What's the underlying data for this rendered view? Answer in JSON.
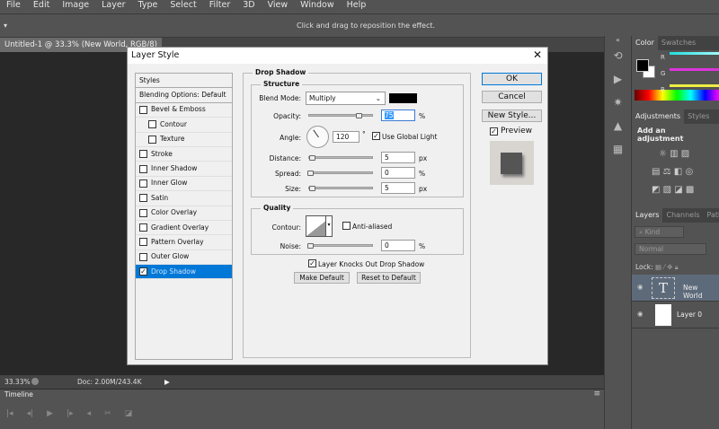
{
  "menu": [
    "File",
    "Edit",
    "Image",
    "Layer",
    "Type",
    "Select",
    "Filter",
    "3D",
    "View",
    "Window",
    "Help"
  ],
  "options_hint": "Click and drag to reposition the effect.",
  "doc_tab": "Untitled-1 @ 33.3% (New World, RGB/8) *",
  "status": {
    "zoom": "33.33%",
    "doc": "Doc: 2.00M/243.4K"
  },
  "timeline": {
    "title": "Timeline"
  },
  "panels": {
    "color_tabs": [
      "Color",
      "Swatches"
    ],
    "channels": [
      "R",
      "G",
      "B"
    ],
    "adj_tabs": [
      "Adjustments",
      "Styles"
    ],
    "adj_title": "Add an adjustment",
    "layer_tabs": [
      "Layers",
      "Channels",
      "Paths"
    ],
    "kind": "Kind",
    "blend": "Normal",
    "lock": "Lock:",
    "layers": [
      {
        "name": "New World",
        "type": "text",
        "selected": true
      },
      {
        "name": "Layer 0",
        "type": "pixel",
        "selected": false
      }
    ]
  },
  "dialog": {
    "title": "Layer Style",
    "styles_header": "Styles",
    "blending": "Blending Options: Default",
    "items": [
      {
        "label": "Bevel & Emboss",
        "checked": false,
        "indent": false
      },
      {
        "label": "Contour",
        "checked": false,
        "indent": true
      },
      {
        "label": "Texture",
        "checked": false,
        "indent": true
      },
      {
        "label": "Stroke",
        "checked": false,
        "indent": false
      },
      {
        "label": "Inner Shadow",
        "checked": false,
        "indent": false
      },
      {
        "label": "Inner Glow",
        "checked": false,
        "indent": false
      },
      {
        "label": "Satin",
        "checked": false,
        "indent": false
      },
      {
        "label": "Color Overlay",
        "checked": false,
        "indent": false
      },
      {
        "label": "Gradient Overlay",
        "checked": false,
        "indent": false
      },
      {
        "label": "Pattern Overlay",
        "checked": false,
        "indent": false
      },
      {
        "label": "Outer Glow",
        "checked": false,
        "indent": false
      },
      {
        "label": "Drop Shadow",
        "checked": true,
        "indent": false,
        "selected": true
      }
    ],
    "section": "Drop Shadow",
    "structure": {
      "title": "Structure",
      "blend_label": "Blend Mode:",
      "blend_value": "Multiply",
      "shadow_color": "#000000",
      "opacity_label": "Opacity:",
      "opacity": "75",
      "opacity_unit": "%",
      "angle_label": "Angle:",
      "angle": "120",
      "angle_unit": "°",
      "global_light": "Use Global Light",
      "distance_label": "Distance:",
      "distance": "5",
      "distance_unit": "px",
      "spread_label": "Spread:",
      "spread": "0",
      "spread_unit": "%",
      "size_label": "Size:",
      "size": "5",
      "size_unit": "px"
    },
    "quality": {
      "title": "Quality",
      "contour_label": "Contour:",
      "anti_aliased": "Anti-aliased",
      "noise_label": "Noise:",
      "noise": "0",
      "noise_unit": "%"
    },
    "knockout": "Layer Knocks Out Drop Shadow",
    "make_default": "Make Default",
    "reset_default": "Reset to Default",
    "ok": "OK",
    "cancel": "Cancel",
    "new_style": "New Style...",
    "preview": "Preview"
  }
}
